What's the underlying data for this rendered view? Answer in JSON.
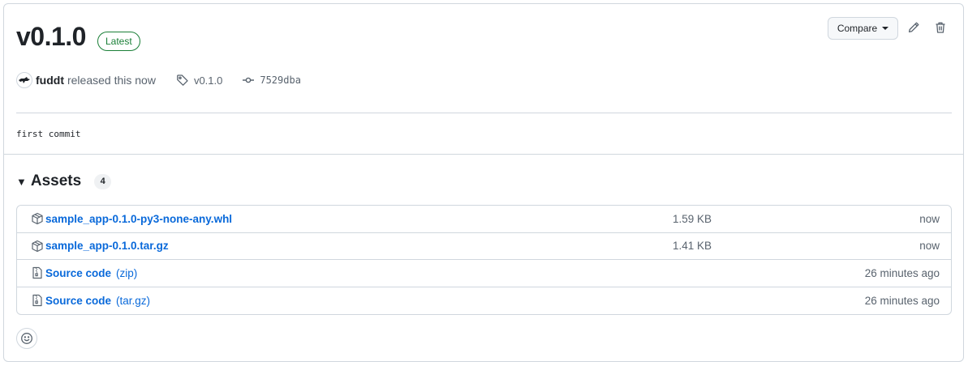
{
  "release": {
    "title": "v0.1.0",
    "badge": "Latest",
    "author": "fuddt",
    "released_text": "released this now",
    "tag": "v0.1.0",
    "commit": "7529dba",
    "notes": "first commit"
  },
  "toolbar": {
    "compare_label": "Compare",
    "edit_icon": "pencil-icon",
    "delete_icon": "trash-icon"
  },
  "assets": {
    "title": "Assets",
    "count": "4",
    "items": [
      {
        "name": "sample_app-0.1.0-py3-none-any.whl",
        "suffix": "",
        "size": "1.59 KB",
        "time": "now",
        "icon": "package-icon"
      },
      {
        "name": "sample_app-0.1.0.tar.gz",
        "suffix": "",
        "size": "1.41 KB",
        "time": "now",
        "icon": "package-icon"
      },
      {
        "name": "Source code",
        "suffix": "(zip)",
        "size": "",
        "time": "26 minutes ago",
        "icon": "file-zip-icon"
      },
      {
        "name": "Source code",
        "suffix": "(tar.gz)",
        "size": "",
        "time": "26 minutes ago",
        "icon": "file-zip-icon"
      }
    ]
  },
  "colors": {
    "link": "#0969da",
    "success": "#1a7f37",
    "border": "#d0d7de",
    "muted": "#59636e"
  }
}
